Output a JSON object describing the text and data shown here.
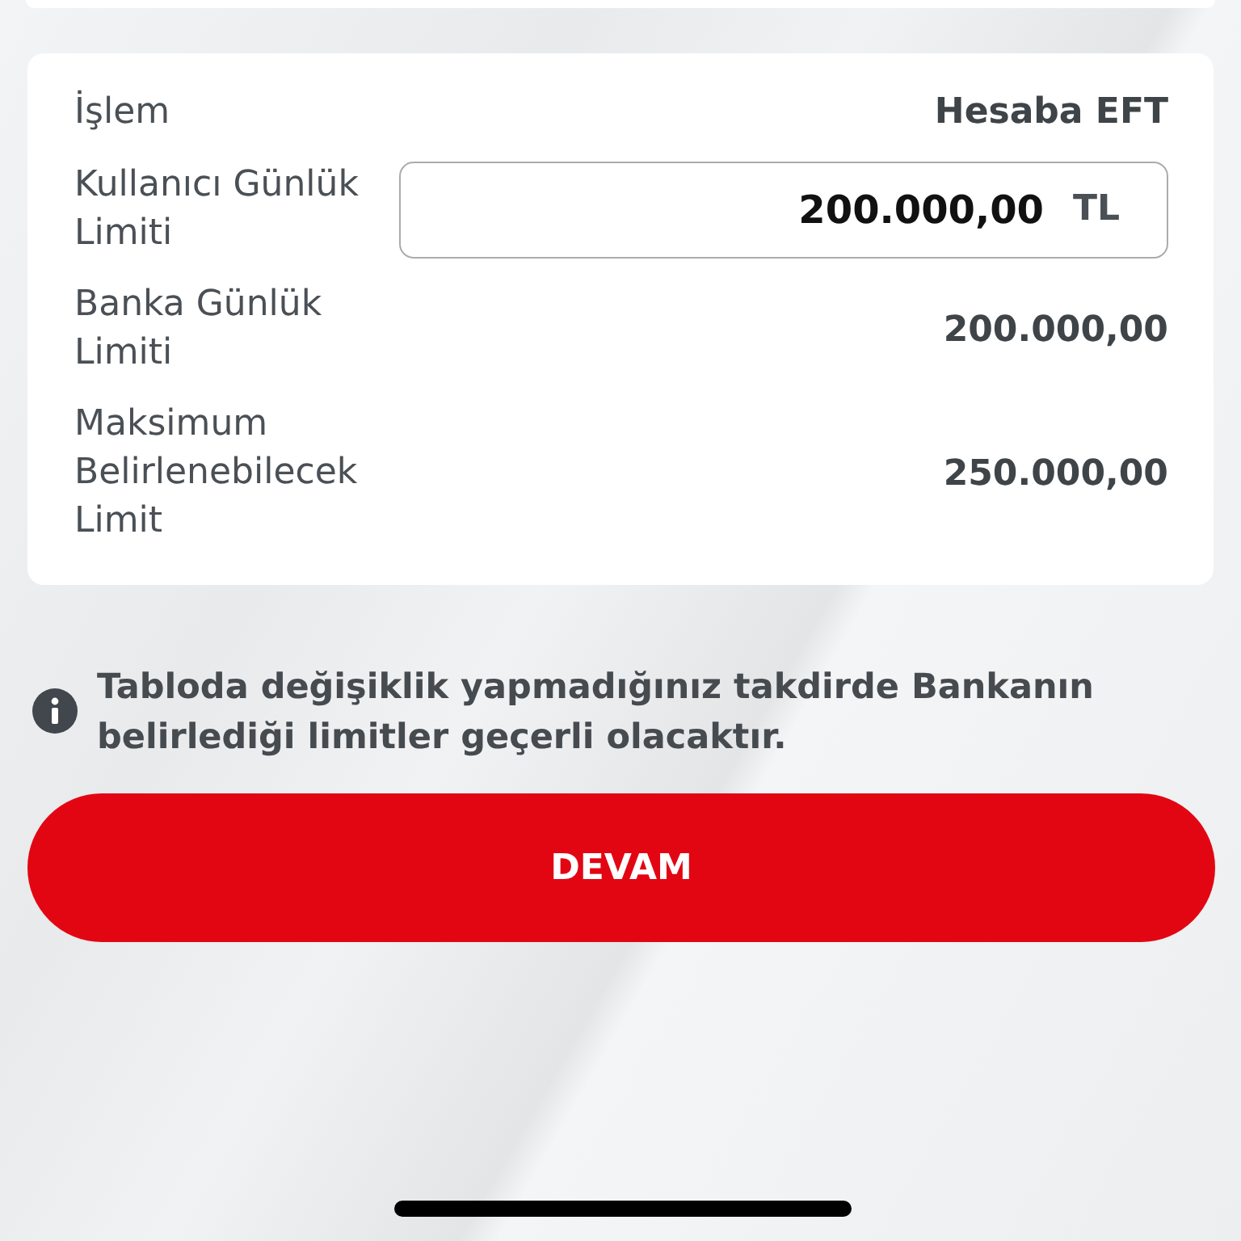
{
  "limits": [
    {
      "kind": "text",
      "label": "İşlem",
      "value": "Hesaba EFT"
    },
    {
      "kind": "input",
      "label": "Kullanıcı Günlük Limiti",
      "value": "200.000,00",
      "unit": "TL"
    },
    {
      "kind": "text",
      "label": "Banka Günlük Limiti",
      "value": "200.000,00"
    },
    {
      "kind": "text",
      "label": "Maksimum Belirlenebilecek Limit",
      "value": "250.000,00"
    }
  ],
  "info": {
    "text": "Tabloda değişiklik yapmadığınız takdirde Bankanın belirlediği limitler geçerli olacaktır."
  },
  "button": {
    "label": "DEVAM"
  }
}
